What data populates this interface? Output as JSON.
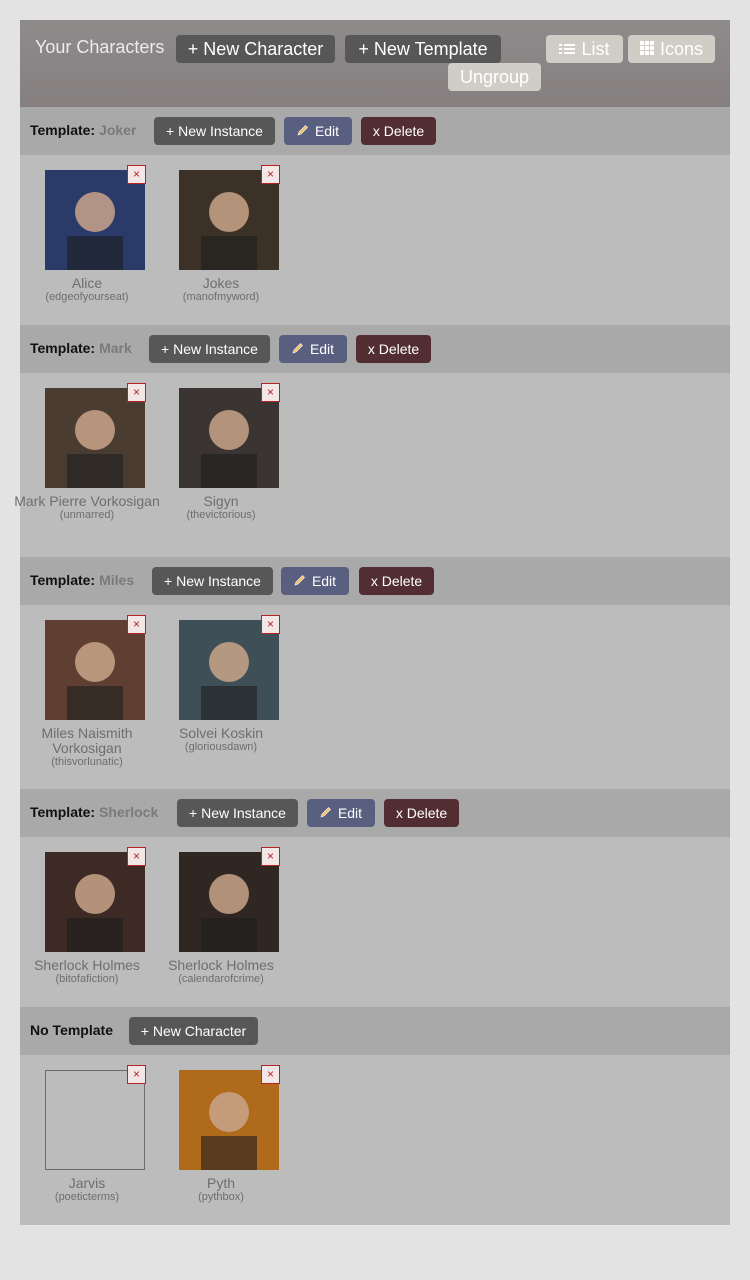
{
  "header": {
    "title": "Your Characters",
    "new_character": "+ New Character",
    "new_template": "+ New Template",
    "list": "List",
    "icons": "Icons",
    "ungroup": "Ungroup"
  },
  "labels": {
    "template_prefix": "Template:",
    "new_instance": "+ New Instance",
    "edit": "Edit",
    "delete": "x Delete",
    "close": "×",
    "no_template": "No Template",
    "new_character": "+ New Character"
  },
  "sections": [
    {
      "template": "Joker",
      "characters": [
        {
          "name": "Alice",
          "handle": "(edgeofyourseat)",
          "thumb": "#2a3b6a"
        },
        {
          "name": "Jokes",
          "handle": "(manofmyword)",
          "thumb": "#3b3127"
        }
      ]
    },
    {
      "template": "Mark",
      "characters": [
        {
          "name": "Mark Pierre Vorkosigan",
          "handle": "(unmarred)",
          "thumb": "#4a3c31"
        },
        {
          "name": "Sigyn",
          "handle": "(thevictorious)",
          "thumb": "#3a3432"
        }
      ]
    },
    {
      "template": "Miles",
      "characters": [
        {
          "name": "Miles Naismith Vorkosigan",
          "handle": "(thisvorlunatic)",
          "thumb": "#5e3f32"
        },
        {
          "name": "Solvei Koskin",
          "handle": "(gloriousdawn)",
          "thumb": "#3f4f58"
        }
      ]
    },
    {
      "template": "Sherlock",
      "characters": [
        {
          "name": "Sherlock Holmes",
          "handle": "(bitofafiction)",
          "thumb": "#3d2a24"
        },
        {
          "name": "Sherlock Holmes",
          "handle": "(calendarofcrime)",
          "thumb": "#302622"
        }
      ]
    }
  ],
  "no_template": {
    "characters": [
      {
        "name": "Jarvis",
        "handle": "(poeticterms)",
        "thumb": ""
      },
      {
        "name": "Pyth",
        "handle": "(pythbox)",
        "thumb": "#b06a1c"
      }
    ]
  }
}
